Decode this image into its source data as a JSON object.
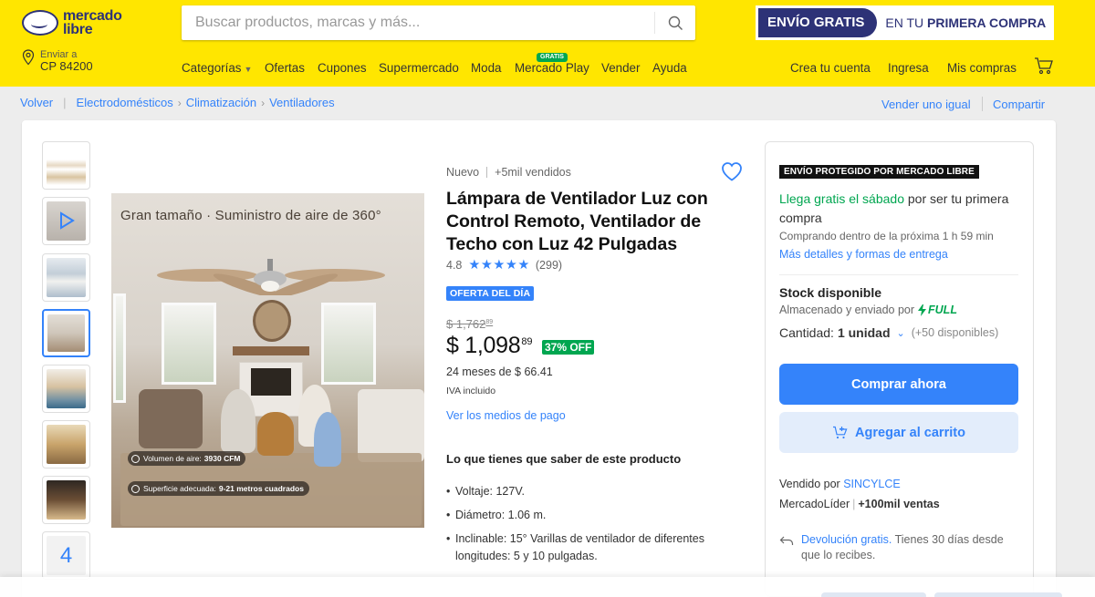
{
  "header": {
    "logo_line1": "mercado",
    "logo_line2": "libre",
    "search_placeholder": "Buscar productos, marcas y más...",
    "promo_left": "ENVÍO GRATIS",
    "promo_right_pre": "EN TU ",
    "promo_right_bold": "PRIMERA COMPRA",
    "location_label": "Enviar a",
    "location_cp": "CP 84200",
    "nav": [
      "Categorías",
      "Ofertas",
      "Cupones",
      "Supermercado",
      "Moda",
      "Mercado Play",
      "Vender",
      "Ayuda"
    ],
    "play_badge": "GRATIS",
    "account": [
      "Crea tu cuenta",
      "Ingresa",
      "Mis compras"
    ]
  },
  "breadcrumb": {
    "back": "Volver",
    "path": [
      "Electrodomésticos",
      "Climatización",
      "Ventiladores"
    ],
    "sell_same": "Vender uno igual",
    "share": "Compartir"
  },
  "gallery": {
    "more_count": "4",
    "image_headline": "Gran tamaño · Suministro de aire de 360°",
    "spec1_label": "Volumen de aire:",
    "spec1_value": "3930 CFM",
    "spec2_label": "Superficie adecuada:",
    "spec2_value": "9-21 metros cuadrados"
  },
  "product": {
    "condition": "Nuevo",
    "sold": "+5mil vendidos",
    "title": "Lámpara de Ventilador Luz con Control Remoto, Ventilador de Techo con Luz 42 Pulgadas",
    "rating": "4.8",
    "stars": "★★★★★",
    "reviews": "(299)",
    "deal_badge": "OFERTA DEL DÍA",
    "old_price": "$ 1,762",
    "old_price_cents": "89",
    "price": "$ 1,098",
    "price_cents": "89",
    "discount": "37% OFF",
    "installments": "24 meses de $ 66.41",
    "iva": "IVA incluido",
    "payment_link": "Ver los medios de pago",
    "features_title": "Lo que tienes que saber de este producto",
    "features": [
      "Voltaje: 127V.",
      "Diámetro: 1.06 m.",
      "Inclinable: 15° Varillas de ventilador de diferentes longitudes: 5 y 10 pulgadas."
    ]
  },
  "buybox": {
    "protected": "ENVÍO PROTEGIDO POR MERCADO LIBRE",
    "arrive_green": "Llega gratis el sábado",
    "arrive_rest": " por ser tu primera compra",
    "arrive_sub": "Comprando dentro de la próxima 1 h 59 min",
    "details_link": "Más detalles y formas de entrega",
    "stock": "Stock disponible",
    "stored": "Almacenado y enviado por",
    "full": "FULL",
    "qty_label": "Cantidad:",
    "qty_value": "1 unidad",
    "qty_available": "(+50 disponibles)",
    "buy_now": "Comprar ahora",
    "add_cart": "Agregar al carrito",
    "seller_pre": "Vendido por ",
    "seller_name": "SINCYLCE",
    "leader": "MercadoLíder",
    "sales": "+100mil ventas",
    "return_link": "Devolución gratis.",
    "return_text": " Tienes 30 días desde que lo recibes."
  },
  "colors": {
    "brand_yellow": "#ffe600",
    "brand_blue": "#3483fa",
    "green": "#00a650",
    "navy": "#2d3277"
  }
}
